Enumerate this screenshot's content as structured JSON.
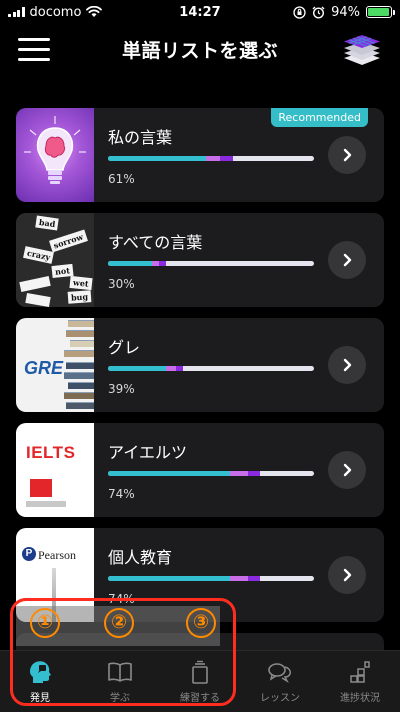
{
  "status_bar": {
    "carrier": "docomo",
    "time": "14:27",
    "battery": "94%",
    "battery_level": 0.94
  },
  "header": {
    "title": "単語リストを選ぶ",
    "menu_icon": "hamburger-menu-icon",
    "stack_icon": "layers-stack-icon"
  },
  "lists": [
    {
      "title": "私の言葉",
      "percent": "61%",
      "badge": "Recommended",
      "thumb": "brain-bulb"
    },
    {
      "title": "すべての言葉",
      "percent": "30%",
      "thumb": "word-chips"
    },
    {
      "title": "グレ",
      "percent": "39%",
      "thumb": "gre-books",
      "logo_text": "GRE"
    },
    {
      "title": "アイエルツ",
      "percent": "74%",
      "thumb": "ielts",
      "logo_text": "IELTS"
    },
    {
      "title": "個人教育",
      "percent": "74%",
      "thumb": "pearson",
      "logo_text": "Pearson"
    }
  ],
  "word_chips": [
    "bad",
    "sorrow",
    "crazy",
    "not",
    "wet",
    "bug"
  ],
  "tabs": [
    {
      "label": "発見",
      "icon": "discover-head-icon",
      "active": true
    },
    {
      "label": "学ぶ",
      "icon": "book-icon",
      "active": false
    },
    {
      "label": "練習する",
      "icon": "practice-card-icon",
      "active": false
    },
    {
      "label": "レッスン",
      "icon": "chat-bubbles-icon",
      "active": false
    },
    {
      "label": "進捗状況",
      "icon": "progress-blocks-icon",
      "active": false
    }
  ],
  "annotations": [
    "①",
    "②",
    "③"
  ],
  "colors": {
    "accent_teal": "#33bfcf",
    "progress_violet": "#c86ee8",
    "progress_purple": "#8a2be2",
    "annotation_red": "#ff2d20",
    "annotation_orange": "#ff8a00"
  }
}
